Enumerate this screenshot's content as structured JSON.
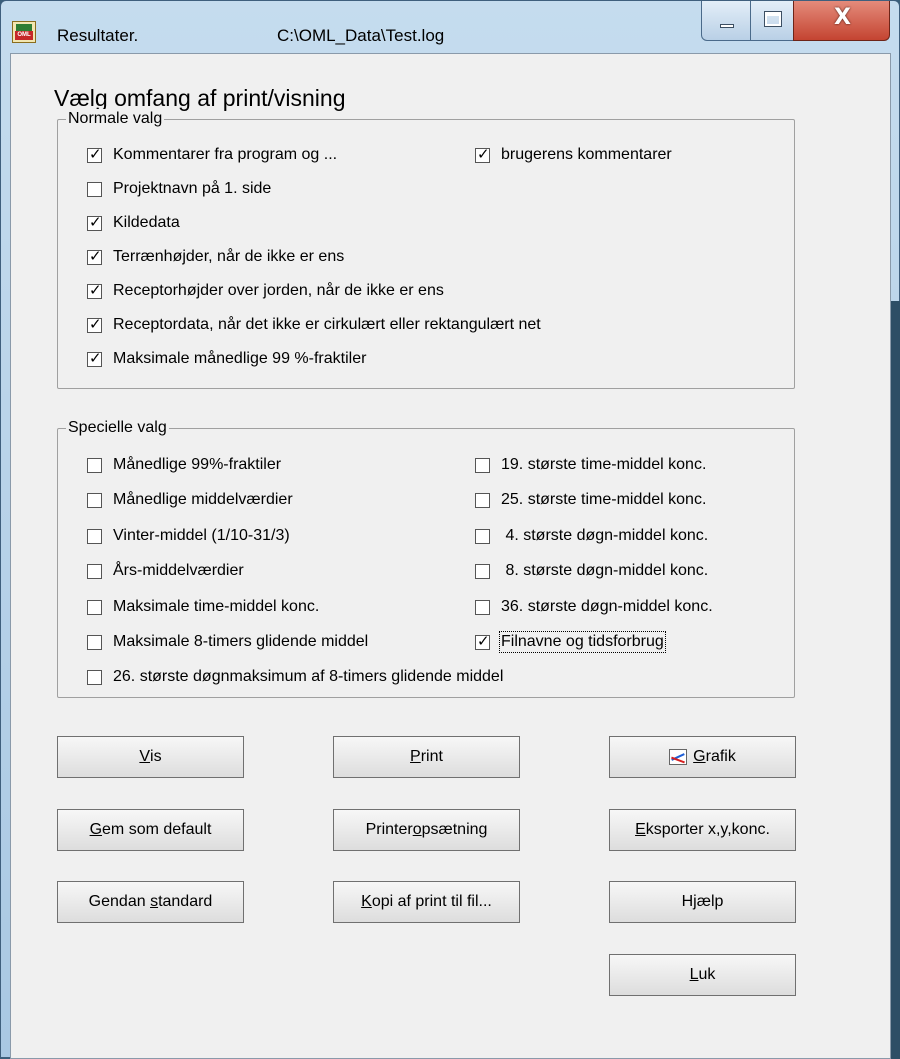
{
  "window": {
    "title": "Resultater.",
    "path": "C:\\OML_Data\\Test.log",
    "icon_label": "OML",
    "close_glyph": "X"
  },
  "heading": "Vælg omfang af print/visning",
  "normal": {
    "title": "Normale valg",
    "items": [
      {
        "label": "Kommentarer fra program og ...",
        "checked": true
      },
      {
        "label": "brugerens kommentarer",
        "checked": true
      },
      {
        "label": "Projektnavn på 1. side",
        "checked": false
      },
      {
        "label": "Kildedata",
        "checked": true
      },
      {
        "label": "Terrænhøjder, når de ikke er ens",
        "checked": true
      },
      {
        "label": "Receptorhøjder over jorden, når de ikke er ens",
        "checked": true
      },
      {
        "label": "Receptordata, når det ikke er cirkulært eller rektangulært net",
        "checked": true
      },
      {
        "label": "Maksimale månedlige 99 %-fraktiler",
        "checked": true
      }
    ]
  },
  "special": {
    "title": "Specielle valg",
    "items": [
      {
        "label": "Månedlige 99%-fraktiler",
        "checked": false
      },
      {
        "label": "19. største time-middel konc.",
        "checked": false
      },
      {
        "label": "Månedlige middelværdier",
        "checked": false
      },
      {
        "label": "25. største time-middel konc.",
        "checked": false
      },
      {
        "label": "Vinter-middel (1/10-31/3)",
        "checked": false
      },
      {
        "label": " 4. største døgn-middel konc.",
        "checked": false
      },
      {
        "label": "Års-middelværdier",
        "checked": false
      },
      {
        "label": " 8. største døgn-middel konc.",
        "checked": false
      },
      {
        "label": "Maksimale time-middel konc.",
        "checked": false
      },
      {
        "label": "36. største døgn-middel konc.",
        "checked": false
      },
      {
        "label": "Maksimale 8-timers glidende middel",
        "checked": false
      },
      {
        "label": "Filnavne og tidsforbrug",
        "checked": true
      },
      {
        "label": "26. største døgnmaksimum af 8-timers glidende middel",
        "checked": false
      }
    ]
  },
  "buttons": {
    "vis": {
      "pre": "",
      "key": "V",
      "post": "is"
    },
    "print": {
      "pre": "",
      "key": "P",
      "post": "rint"
    },
    "grafik": {
      "pre": "",
      "key": "G",
      "post": "rafik"
    },
    "gem": {
      "pre": "",
      "key": "G",
      "post": "em som default"
    },
    "printer": {
      "pre": "Printer",
      "key": "o",
      "post": "psætning"
    },
    "eksport": {
      "pre": "",
      "key": "E",
      "post": "ksporter x,y,konc."
    },
    "gendan": {
      "pre": "Gendan ",
      "key": "s",
      "post": "tandard"
    },
    "kopi": {
      "pre": "",
      "key": "K",
      "post": "opi af print til fil..."
    },
    "hjaelp": {
      "pre": "H",
      "key": "j",
      "post": "ælp"
    },
    "luk": {
      "pre": "",
      "key": "L",
      "post": "uk"
    }
  }
}
